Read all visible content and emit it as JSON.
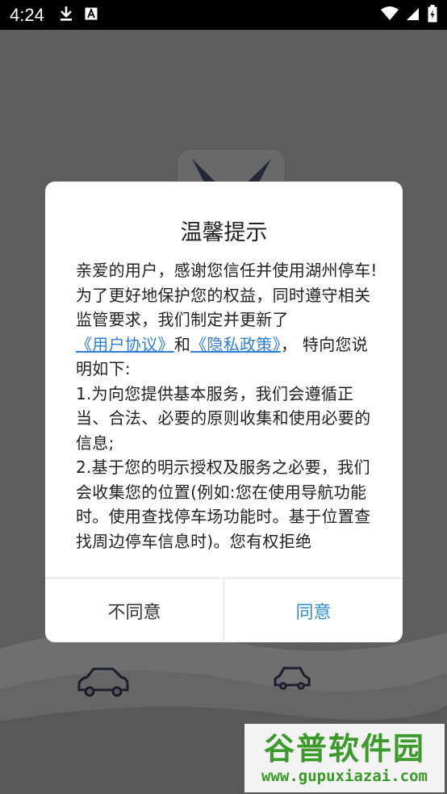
{
  "status_bar": {
    "time": "4:24",
    "icons_left": [
      "download-icon",
      "font-a-icon"
    ],
    "icons_right": [
      "wifi-icon",
      "signal-icon",
      "battery-icon"
    ]
  },
  "dialog": {
    "title": "温馨提示",
    "body": {
      "intro": "亲爱的用户，感谢您信任并使用湖州停车!为了更好地保护您的权益，同时遵守相关监管要求，我们制定并更新了",
      "link_user_agreement": "《用户协议》",
      "and_text": "和",
      "link_privacy_policy": "《隐私政策》",
      "after_links": "， 特向您说明如下:",
      "point1": "1.为向您提供基本服务，我们会遵循正当、合法、必要的原则收集和使用必要的信息;",
      "point2": "2.基于您的明示授权及服务之必要，我们会收集您的位置(例如:您在使用导航功能时。使用查找停车场功能时。基于位置查找周边停车信息时)。您有权拒绝"
    },
    "buttons": {
      "disagree": "不同意",
      "agree": "同意"
    }
  },
  "colors": {
    "link": "#2f7fd8",
    "agree_button": "#2f8fd8",
    "watermark": "#3a9a2a"
  },
  "watermark": {
    "title": "谷普软件园",
    "url": "www.gupuxiazai.com"
  }
}
